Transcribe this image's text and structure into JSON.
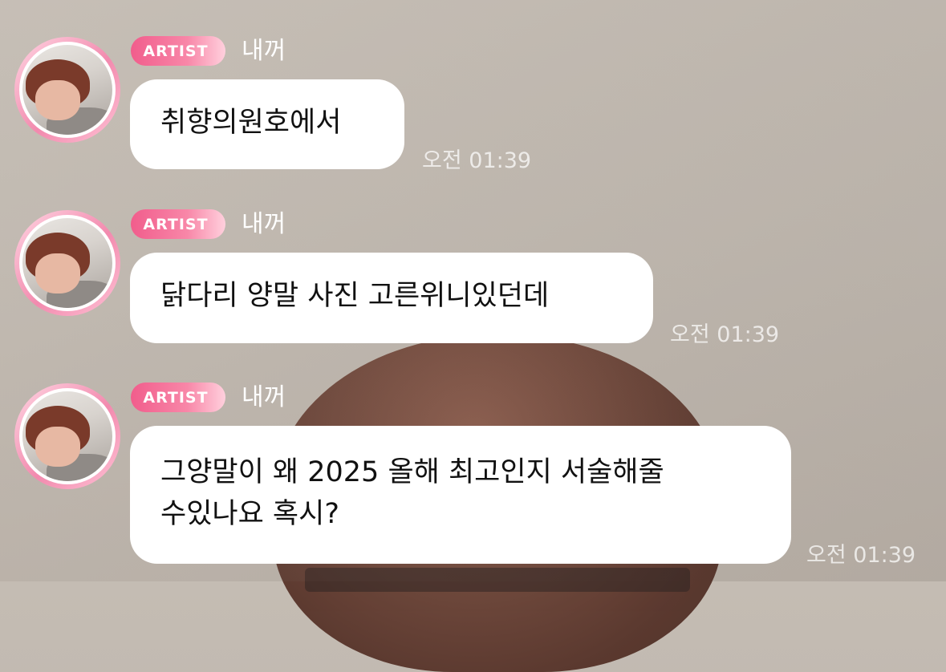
{
  "messages": [
    {
      "badge": "ARTIST",
      "sender": "내꺼",
      "text_lines": [
        "취향의원호에서"
      ],
      "time": "오전 01:39"
    },
    {
      "badge": "ARTIST",
      "sender": "내꺼",
      "text_lines": [
        "닭다리 양말 사진 고른위니있던데"
      ],
      "time": "오전 01:39"
    },
    {
      "badge": "ARTIST",
      "sender": "내꺼",
      "text_lines": [
        "그양말이 왜 2025 올해 최고인지 서술해줄",
        "수있나요 혹시?"
      ],
      "time": "오전 01:39"
    }
  ],
  "colors": {
    "badge_gradient_start": "#f15d8c",
    "badge_gradient_end": "#ffd0dd",
    "bubble": "#ffffff",
    "background": "#c2bab1"
  }
}
